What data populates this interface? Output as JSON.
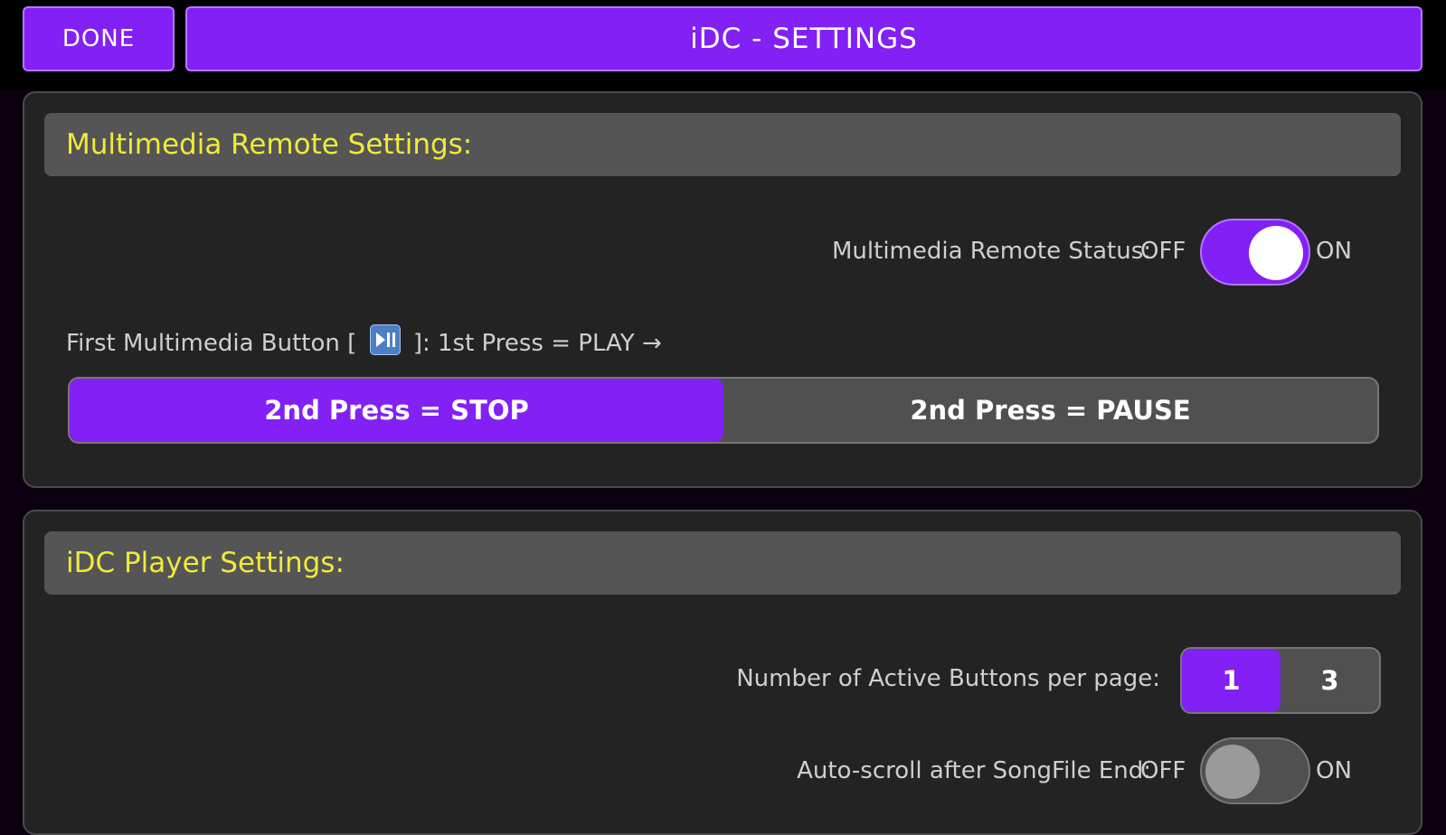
{
  "header": {
    "done_label": "DONE",
    "title": "iDC - SETTINGS"
  },
  "multimedia_section": {
    "heading": "Multimedia Remote Settings:",
    "status_label": "Multimedia Remote Status:",
    "off_label": "OFF",
    "on_label": "ON",
    "status_on": true,
    "first_button_prefix": "First Multimedia Button [",
    "first_button_icon": "play-pause-icon",
    "first_button_suffix": "]: 1st Press = PLAY →",
    "options": [
      "2nd Press = STOP",
      "2nd Press = PAUSE"
    ],
    "selected_option": "2nd Press = STOP"
  },
  "player_section": {
    "heading": "iDC Player Settings:",
    "buttons_label": "Number of Active Buttons per page:",
    "buttons_options": [
      "1",
      "3"
    ],
    "buttons_selected": "1",
    "autoscroll_label": "Auto-scroll after SongFile End:",
    "off_label": "OFF",
    "on_label": "ON",
    "autoscroll_on": false
  },
  "colors": {
    "accent": "#8220f5",
    "heading_text": "#f0ea3a",
    "panel_bg": "#232323",
    "header_bg": "#555555"
  }
}
